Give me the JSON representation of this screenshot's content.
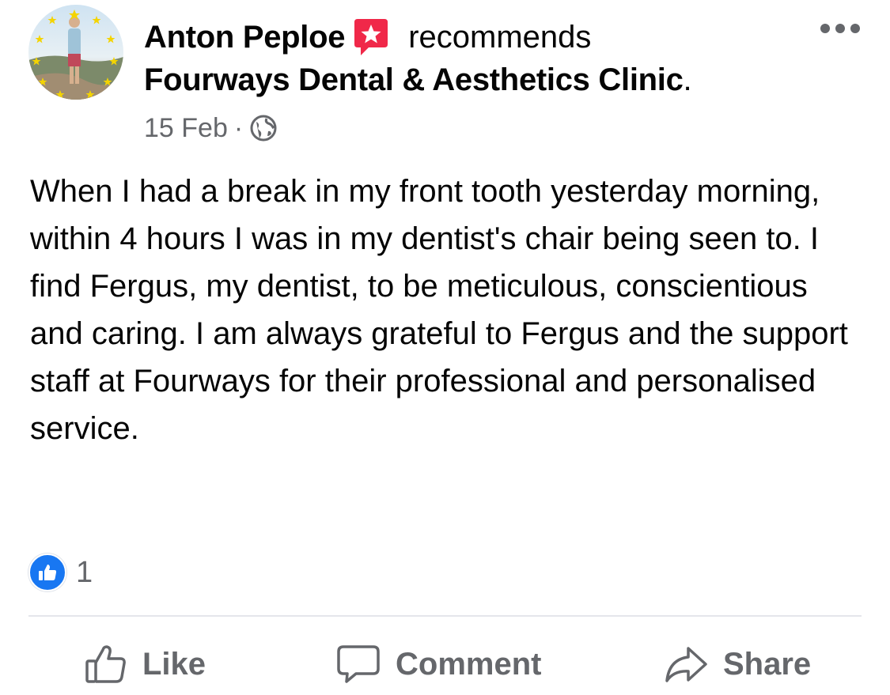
{
  "post": {
    "author": "Anton Peploe",
    "action": "recommends",
    "page_name": "Fourways Dental & Aesthetics Clinic",
    "page_suffix": ".",
    "date": "15 Feb",
    "separator": "·",
    "audience_icon": "globe-icon",
    "body": "When I had a break in my front tooth yesterday morning, within 4 hours I was in my dentist's chair being seen to. I find Fergus, my dentist, to be meticulous, conscientious and caring. I am always grateful to Fergus and the support staff at Fourways for their professional and personalised service."
  },
  "reactions": {
    "icon": "thumbs-up-icon",
    "count": "1"
  },
  "actions": {
    "like": "Like",
    "comment": "Comment",
    "share": "Share"
  },
  "colors": {
    "text": "#050505",
    "secondary": "#65676b",
    "like_blue": "#1877f2",
    "recommend_red": "#f02849",
    "divider": "#e4e6eb"
  }
}
